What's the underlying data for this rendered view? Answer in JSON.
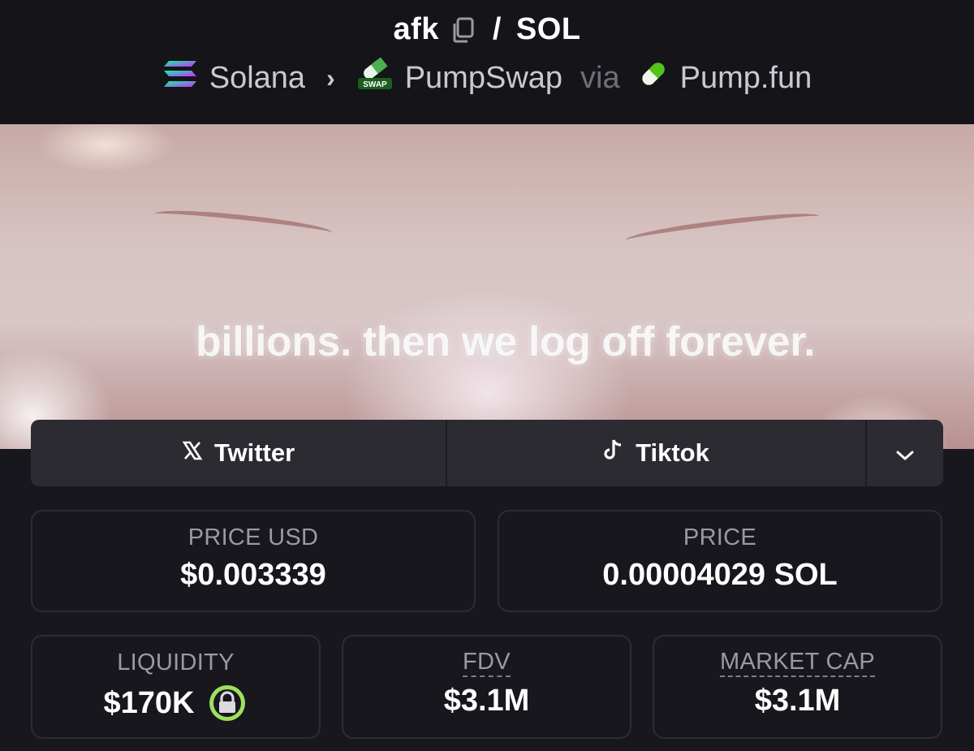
{
  "header": {
    "token_symbol": "afk",
    "separator": "/",
    "quote_symbol": "SOL",
    "chain": "Solana",
    "dex": "PumpSwap",
    "dex_icon_text": "SWAP",
    "via_label": "via",
    "launchpad": "Pump.fun"
  },
  "banner": {
    "caption": "billions. then we log off forever."
  },
  "socials": {
    "twitter_label": "Twitter",
    "tiktok_label": "Tiktok"
  },
  "stats": {
    "price_usd": {
      "label": "PRICE USD",
      "value": "$0.003339"
    },
    "price_native": {
      "label": "PRICE",
      "value": "0.00004029 SOL"
    },
    "liquidity": {
      "label": "LIQUIDITY",
      "value": "$170K"
    },
    "fdv": {
      "label": "FDV",
      "value": "$3.1M"
    },
    "market_cap": {
      "label": "MARKET CAP",
      "value": "$3.1M"
    }
  },
  "colors": {
    "background": "#17171d",
    "header_bg": "#141419",
    "card_border": "#2c2c33",
    "social_bg": "#2b2b31",
    "label_gray": "#9a9aa3",
    "lock_green": "#9be15d"
  },
  "icons": {
    "copy": "copy-icon",
    "chain": "solana-icon",
    "dex": "pumpswap-icon",
    "launchpad": "pill-icon",
    "twitter": "x-icon",
    "tiktok": "tiktok-icon",
    "more": "chevron-down-icon",
    "lock": "lock-icon"
  }
}
